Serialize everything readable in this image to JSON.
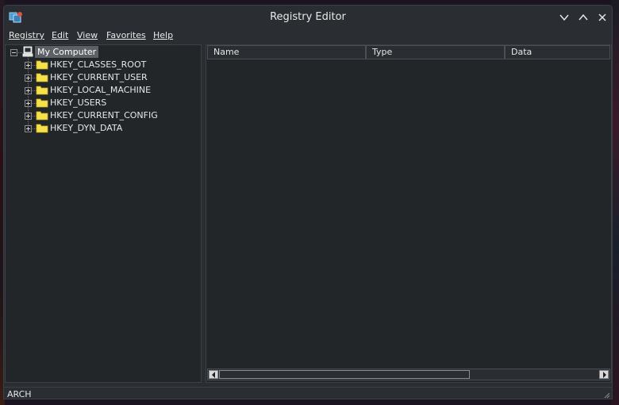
{
  "window": {
    "title": "Registry Editor",
    "icon": "registry-editor-icon"
  },
  "titlebar_buttons": [
    "chevron-down-icon",
    "chevron-up-icon",
    "close-icon"
  ],
  "menu": {
    "registry": "Registry",
    "edit": "Edit",
    "view": "View",
    "favorites": "Favorites",
    "help": "Help"
  },
  "tree": {
    "root": {
      "label": "My Computer",
      "icon": "computer-icon",
      "expanded": true,
      "selected": true
    },
    "keys": [
      {
        "label": "HKEY_CLASSES_ROOT",
        "icon": "folder-icon"
      },
      {
        "label": "HKEY_CURRENT_USER",
        "icon": "folder-icon"
      },
      {
        "label": "HKEY_LOCAL_MACHINE",
        "icon": "folder-icon"
      },
      {
        "label": "HKEY_USERS",
        "icon": "folder-icon"
      },
      {
        "label": "HKEY_CURRENT_CONFIG",
        "icon": "folder-icon"
      },
      {
        "label": "HKEY_DYN_DATA",
        "icon": "folder-icon"
      }
    ]
  },
  "list": {
    "columns": [
      "Name",
      "Type",
      "Data"
    ],
    "rows": []
  },
  "status": {
    "text": "ARCH"
  },
  "colors": {
    "window_bg": "#2a2e32",
    "pane_bg": "#232629",
    "selection_bg": "#5c6166",
    "folder_yellow": "#f5e04a"
  }
}
